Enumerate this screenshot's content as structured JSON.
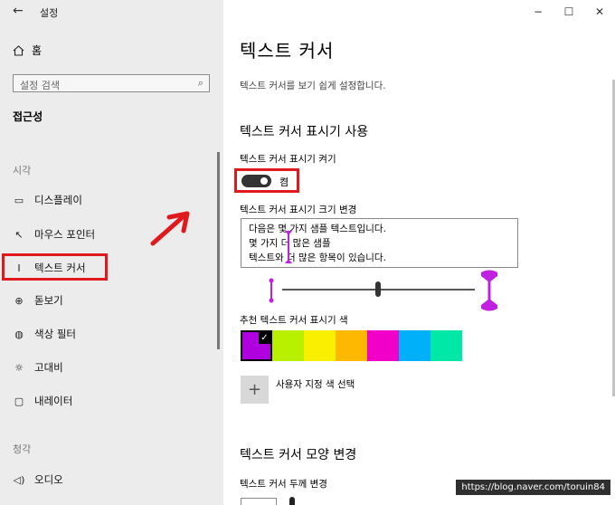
{
  "titlebar": {
    "back": "←",
    "title": "설정",
    "minimize": "−",
    "maximize": "☐",
    "close": "✕"
  },
  "sidebar": {
    "home": "홈",
    "search": {
      "placeholder": "설정 검색"
    },
    "section_title": "접근성",
    "group_vision": "시각",
    "items": [
      {
        "label": "디스플레이",
        "icon": "display-icon"
      },
      {
        "label": "마우스 포인터",
        "icon": "mouse-pointer-icon"
      },
      {
        "label": "텍스트 커서",
        "icon": "text-cursor-icon",
        "selected": true
      },
      {
        "label": "돋보기",
        "icon": "magnifier-icon"
      },
      {
        "label": "색상 필터",
        "icon": "color-filter-icon"
      },
      {
        "label": "고대비",
        "icon": "high-contrast-icon"
      },
      {
        "label": "내레이터",
        "icon": "narrator-icon"
      }
    ],
    "group_hearing": "청각",
    "hearing_items": [
      {
        "label": "오디오",
        "icon": "audio-icon"
      }
    ]
  },
  "content": {
    "title": "텍스트 커서",
    "description": "텍스트 커서를 보기 쉽게 설정합니다.",
    "indicator_section": "텍스트 커서 표시기 사용",
    "indicator_toggle_label": "텍스트 커서 표시기 켜기",
    "indicator_toggle_state": "켬",
    "indicator_size_label": "텍스트 커서 표시기 크기 변경",
    "sample_lines": [
      "다음은 몇 가지 샘플 텍스트입니다.",
      "몇 가지 더 많은 샘플",
      "텍스트와 더 많은 항목이 있습니다."
    ],
    "size_slider_value": 0.5,
    "recommended_colors_label": "추천 텍스트 커서 표시기 색",
    "colors": [
      "#b000e0",
      "#b8f000",
      "#f8f000",
      "#ffb800",
      "#f000c8",
      "#00b0f8",
      "#00e8a8"
    ],
    "selected_color_index": 0,
    "custom_color_label": "사용자 지정 색 선택",
    "appearance_section": "텍스트 커서 모양 변경",
    "thickness_label": "텍스트 커서 두께 변경"
  },
  "watermark": "https://blog.naver.com/toruin84",
  "accent_colors": {
    "annotation_red": "#e0191d",
    "indicator_purple": "#c020e0"
  }
}
